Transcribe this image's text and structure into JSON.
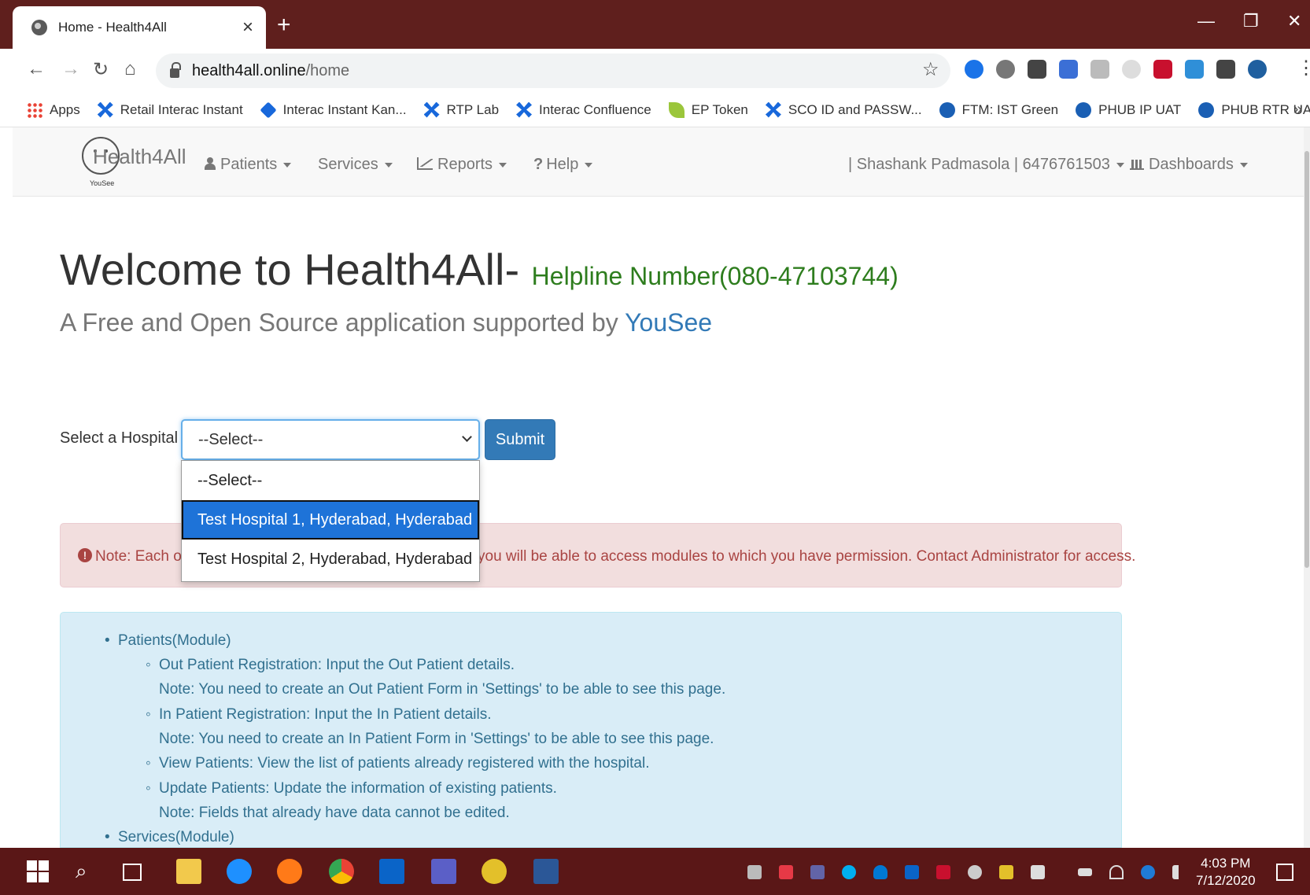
{
  "browser": {
    "tab_title": "Home - Health4All",
    "url_host": "health4all.online",
    "url_path": "/home",
    "new_tab": "+",
    "close_tab": "×",
    "bookmarks": [
      {
        "label": "Apps",
        "icon": "apps-grid-icon"
      },
      {
        "label": "Retail Interac Instant",
        "icon": "confluence-icon"
      },
      {
        "label": "Interac Instant Kan...",
        "icon": "diamond-icon"
      },
      {
        "label": "RTP Lab",
        "icon": "confluence-icon"
      },
      {
        "label": "Interac Confluence",
        "icon": "confluence-icon"
      },
      {
        "label": "EP Token",
        "icon": "leaf-icon"
      },
      {
        "label": "SCO ID and PASSW...",
        "icon": "confluence-icon"
      },
      {
        "label": "FTM: IST Green",
        "icon": "bank-icon"
      },
      {
        "label": "PHUB IP UAT",
        "icon": "bank-icon"
      },
      {
        "label": "PHUB RTR UAT",
        "icon": "bank-icon"
      }
    ],
    "bookmarks_more": "»"
  },
  "navbar": {
    "brand": "Health4All",
    "brand_sub": "YouSee",
    "patients": "Patients",
    "services": "Services",
    "reports": "Reports",
    "help": "Help",
    "help_prefix": "?",
    "user": "| Shashank Padmasola | 6476761503",
    "dashboards": "Dashboards"
  },
  "main": {
    "welcome": "Welcome to Health4All-",
    "helpline": "Helpline Number(080-47103744)",
    "tagline": "A Free and Open Source application supported by",
    "tagline_link": "YouSee",
    "select_label": "Select a Hospital -",
    "select_value": "--Select--",
    "submit": "Submit",
    "dropdown_options": [
      "--Select--",
      "Test Hospital 1, Hyderabad, Hyderabad",
      "Test Hospital 2, Hyderabad, Hyderabad"
    ],
    "selected_option_index": 1,
    "alert_part1": "Note: Each of",
    "alert_part2": "you will be able to access modules to which you have permission. Contact Administrator for access.",
    "info": [
      "Patients(Module)",
      "Out Patient Registration: Input the Out Patient details.",
      "Note: You need to create an Out Patient Form in 'Settings' to be able to see this page.",
      "In Patient Registration: Input the In Patient details.",
      "Note: You need to create an In Patient Form in 'Settings' to be able to see this page.",
      "View Patients: View the list of patients already registered with the hospital.",
      "Update Patients: Update the information of existing patients.",
      "Note: Fields that already have data cannot be edited.",
      "Services(Module)"
    ]
  },
  "taskbar": {
    "time": "4:03 PM",
    "date": "7/12/2020"
  },
  "colors": {
    "tabstrip": "#5f1f1d",
    "taskbar": "#5a1717",
    "primary": "#337ab7",
    "helpline_green": "#2e7d1e",
    "alert_red": "#a94442",
    "info_blue": "#31708f"
  }
}
